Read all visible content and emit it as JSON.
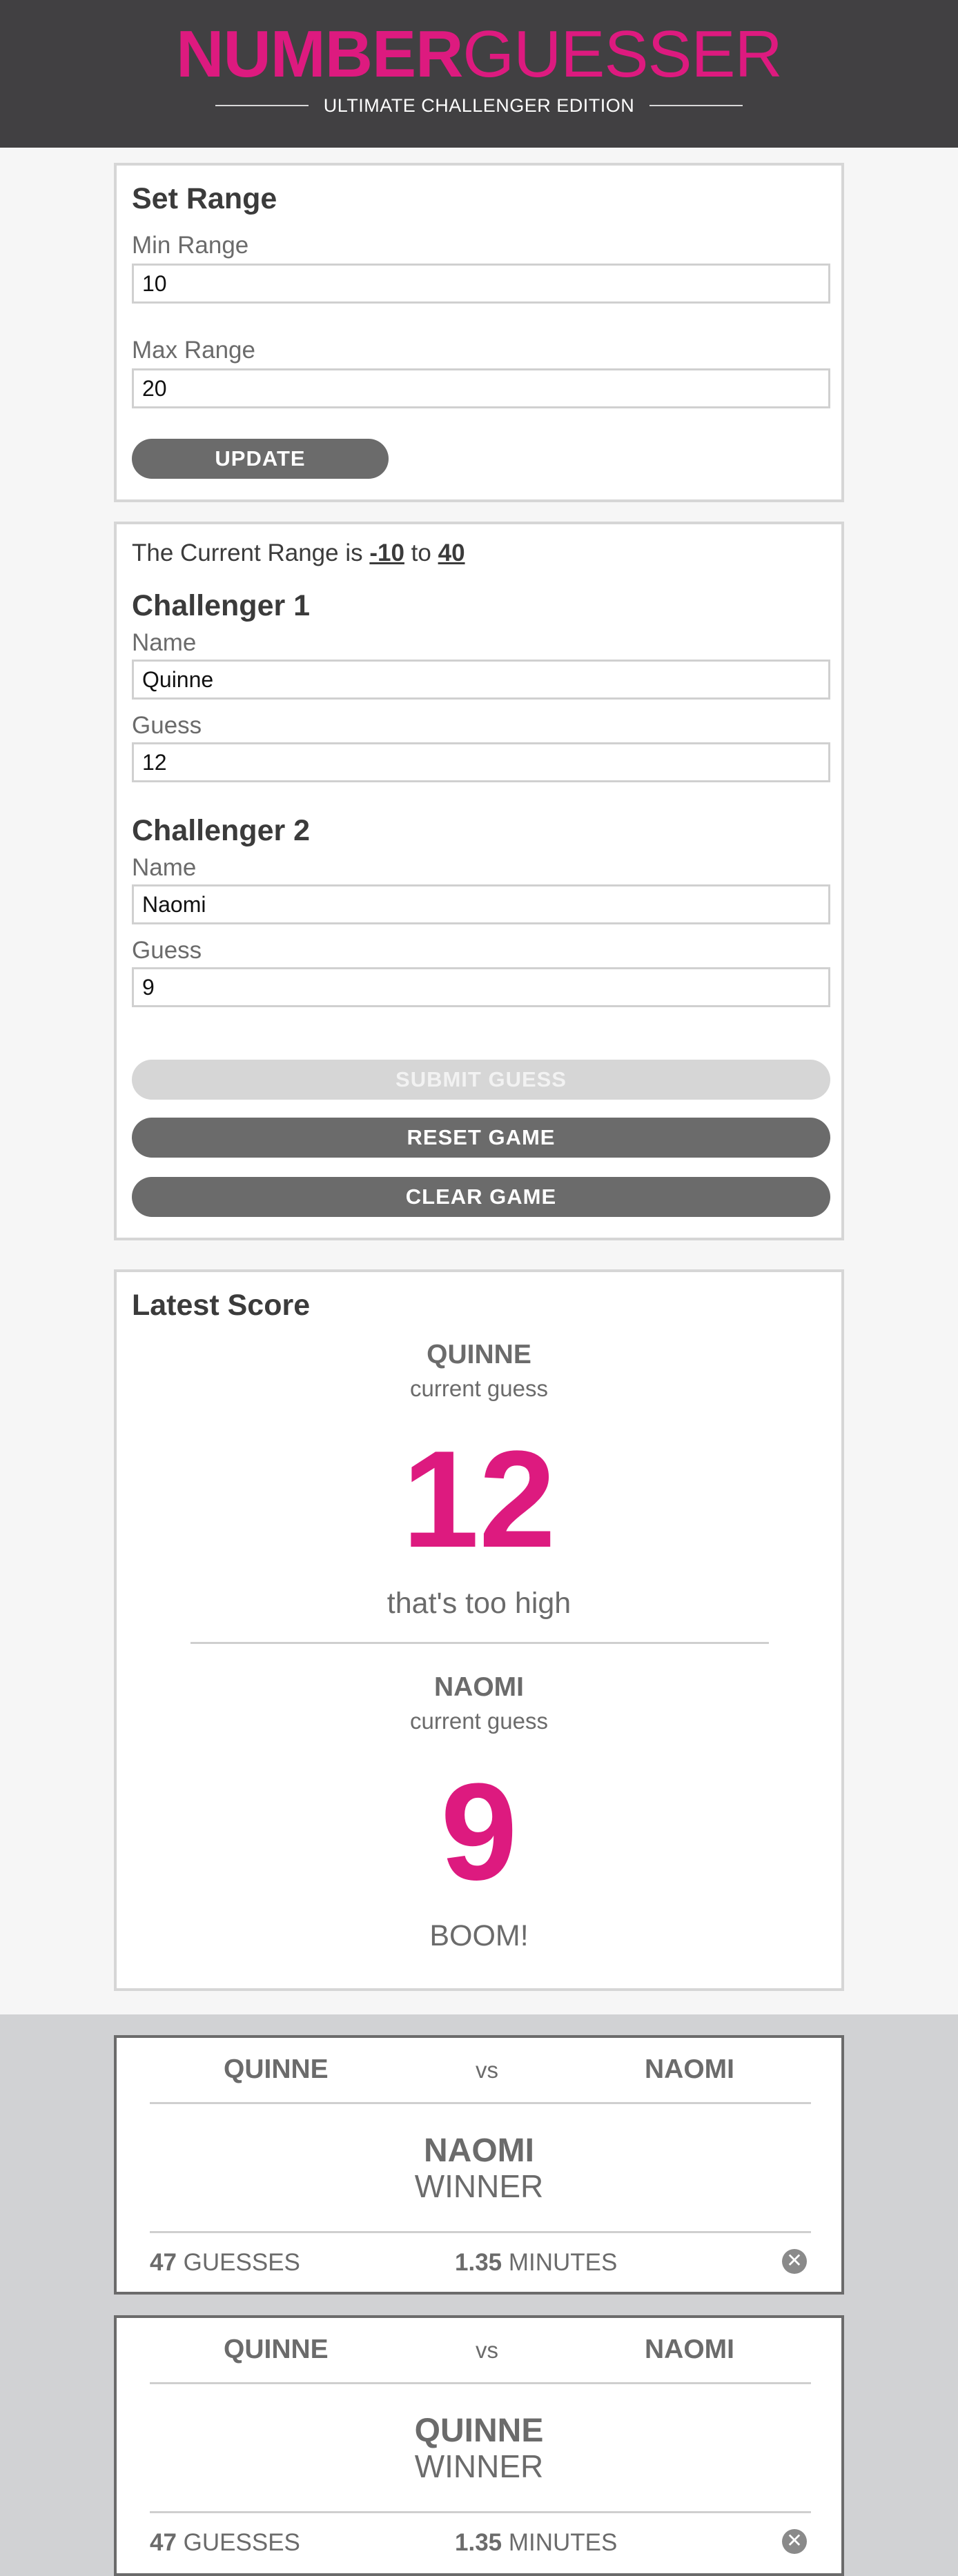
{
  "header": {
    "logo_bold": "NUMBER",
    "logo_light": "GUESSER",
    "subtitle": "ULTIMATE CHALLENGER EDITION"
  },
  "colors": {
    "accent": "#dd1a7f",
    "header_bg": "#414042",
    "button": "#6b6b6b",
    "button_disabled": "#d6d6d6"
  },
  "set_range": {
    "title": "Set Range",
    "min_label": "Min Range",
    "min_value": "10",
    "max_label": "Max Range",
    "max_value": "20",
    "update_label": "UPDATE"
  },
  "challenge": {
    "range_prefix": "The Current Range is",
    "range_min": "-10",
    "range_to": "to",
    "range_max": "40",
    "challenger1": {
      "title": "Challenger 1",
      "name_label": "Name",
      "name_value": "Quinne",
      "guess_label": "Guess",
      "guess_value": "12"
    },
    "challenger2": {
      "title": "Challenger 2",
      "name_label": "Name",
      "name_value": "Naomi",
      "guess_label": "Guess",
      "guess_value": "9"
    },
    "submit_label": "SUBMIT GUESS",
    "reset_label": "RESET GAME",
    "clear_label": "CLEAR GAME"
  },
  "latest_score": {
    "title": "Latest Score",
    "p1": {
      "name": "QUINNE",
      "caption": "current guess",
      "guess": "12",
      "feedback": "that's too high"
    },
    "p2": {
      "name": "NAOMI",
      "caption": "current guess",
      "guess": "9",
      "feedback": "BOOM!"
    }
  },
  "results": [
    {
      "p1": "QUINNE",
      "vs": "vs",
      "p2": "NAOMI",
      "winner": "NAOMI",
      "winner_label": "WINNER",
      "guesses": "47",
      "guesses_label": "GUESSES",
      "minutes": "1.35",
      "minutes_label": "MINUTES",
      "close_icon": "close-icon"
    },
    {
      "p1": "QUINNE",
      "vs": "vs",
      "p2": "NAOMI",
      "winner": "QUINNE",
      "winner_label": "WINNER",
      "guesses": "47",
      "guesses_label": "GUESSES",
      "minutes": "1.35",
      "minutes_label": "MINUTES",
      "close_icon": "close-icon"
    }
  ]
}
